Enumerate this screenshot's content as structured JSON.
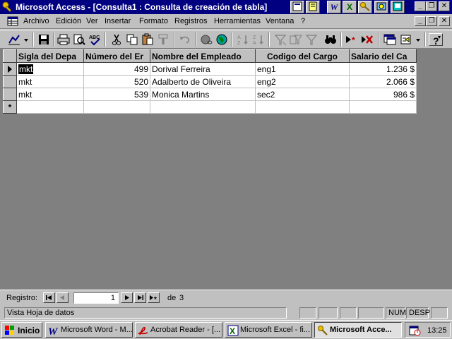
{
  "window": {
    "title": "Microsoft Access - [Consulta1 : Consulta de creación de tabla]"
  },
  "menu": {
    "items": [
      {
        "label": "Archivo"
      },
      {
        "label": "Edición"
      },
      {
        "label": "Ver"
      },
      {
        "label": "Insertar"
      },
      {
        "label": "Formato"
      },
      {
        "label": "Registros"
      },
      {
        "label": "Herramientas"
      },
      {
        "label": "Ventana"
      },
      {
        "label": "?"
      }
    ]
  },
  "toolbar": {
    "buttons": [
      "design-view-icon",
      "save-icon",
      "print-icon",
      "print-preview-icon",
      "spelling-icon",
      "cut-icon",
      "copy-icon",
      "paste-icon",
      "format-painter-icon",
      "undo-icon",
      "hyperlink-icon",
      "web-toolbar-icon",
      "sort-ascending-icon",
      "sort-descending-icon",
      "filter-by-selection-icon",
      "filter-by-form-icon",
      "apply-filter-icon",
      "find-icon",
      "new-record-icon",
      "delete-record-icon",
      "database-window-icon",
      "new-object-icon",
      "help-icon"
    ]
  },
  "grid": {
    "columns": [
      {
        "label": "Sigla del Depa"
      },
      {
        "label": "Número del Er"
      },
      {
        "label": "Nombre del Empleado"
      },
      {
        "label": "Codigo del Cargo"
      },
      {
        "label": "Salario del Ca"
      }
    ],
    "rows": [
      {
        "sigla": "mkt",
        "numero": "499",
        "nombre": "Dorival Ferreira",
        "codigo": "eng1",
        "salario": "1.236 $"
      },
      {
        "sigla": "mkt",
        "numero": "520",
        "nombre": "Adalberto de Oliveira",
        "codigo": "eng2",
        "salario": "2.066 $"
      },
      {
        "sigla": "mkt",
        "numero": "539",
        "nombre": "Monica Martins",
        "codigo": "sec2",
        "salario": "986 $"
      }
    ],
    "new_row_marker": "*"
  },
  "navigation": {
    "label": "Registro:",
    "current": "1",
    "of_label": "de",
    "total": "3"
  },
  "status": {
    "message": "Vista Hoja de datos",
    "num": "NUM",
    "desp": "DESP"
  },
  "taskbar": {
    "start_label": "Inicio",
    "tasks": [
      {
        "label": "Microsoft Word - M..."
      },
      {
        "label": "Acrobat Reader - [..."
      },
      {
        "label": "Microsoft Excel - fi..."
      },
      {
        "label": "Microsoft Acce..."
      }
    ],
    "clock": "13:25"
  },
  "colors": {
    "title_bar": "#000080",
    "face": "#c0c0c0",
    "workspace": "#808080"
  }
}
